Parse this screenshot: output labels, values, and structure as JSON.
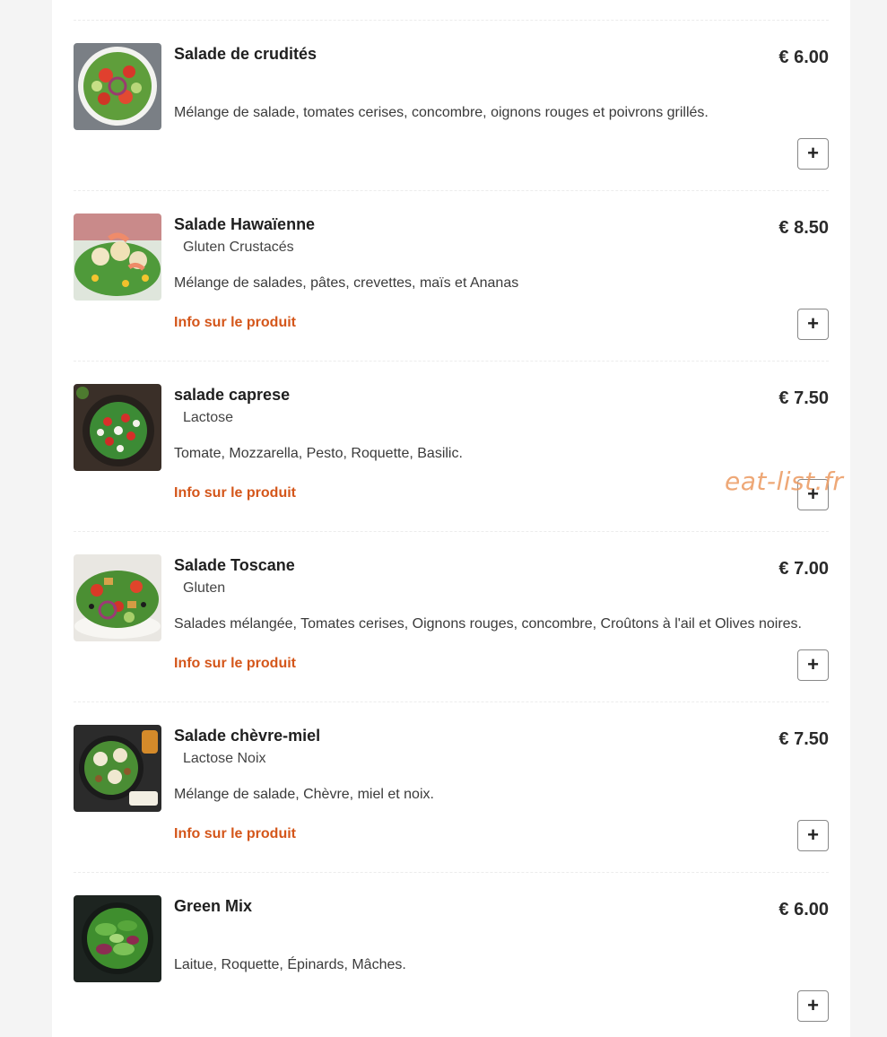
{
  "colors": {
    "accent": "#d4561a",
    "page_bg": "#f4f4f4",
    "panel_bg": "#ffffff"
  },
  "watermark": "eat-list.fr",
  "menu_items": [
    {
      "name": "Salade de crudités",
      "allergens": "",
      "description": "Mélange de salade, tomates cerises, concombre, oignons rouges et poivrons grillés.",
      "price": "€ 6.00",
      "info_label": "",
      "add_label": "+",
      "image_icon": "salad-plate-icon"
    },
    {
      "name": "Salade Hawaïenne",
      "allergens": "Gluten Crustacés",
      "description": "Mélange de salades, pâtes, crevettes, maïs et Ananas",
      "price": "€ 8.50",
      "info_label": "Info sur le produit",
      "add_label": "+",
      "image_icon": "pasta-shrimp-salad-icon"
    },
    {
      "name": "salade caprese",
      "allergens": "Lactose",
      "description": "Tomate, Mozzarella, Pesto, Roquette, Basilic.",
      "price": "€ 7.50",
      "info_label": "Info sur le produit",
      "add_label": "+",
      "image_icon": "caprese-bowl-icon"
    },
    {
      "name": "Salade Toscane",
      "allergens": "Gluten",
      "description": "Salades mélangée, Tomates cerises, Oignons rouges, concombre, Croûtons à l'ail et Olives noires.",
      "price": "€ 7.00",
      "info_label": "Info sur le produit",
      "add_label": "+",
      "image_icon": "tuscan-salad-bowl-icon"
    },
    {
      "name": "Salade chèvre-miel",
      "allergens": "Lactose Noix",
      "description": "Mélange de salade, Chèvre, miel et noix.",
      "price": "€ 7.50",
      "info_label": "Info sur le produit",
      "add_label": "+",
      "image_icon": "goat-cheese-salad-icon"
    },
    {
      "name": "Green Mix",
      "allergens": "",
      "description": "Laitue, Roquette, Épinards, Mâches.",
      "price": "€ 6.00",
      "info_label": "",
      "add_label": "+",
      "image_icon": "green-mix-bowl-icon"
    }
  ]
}
